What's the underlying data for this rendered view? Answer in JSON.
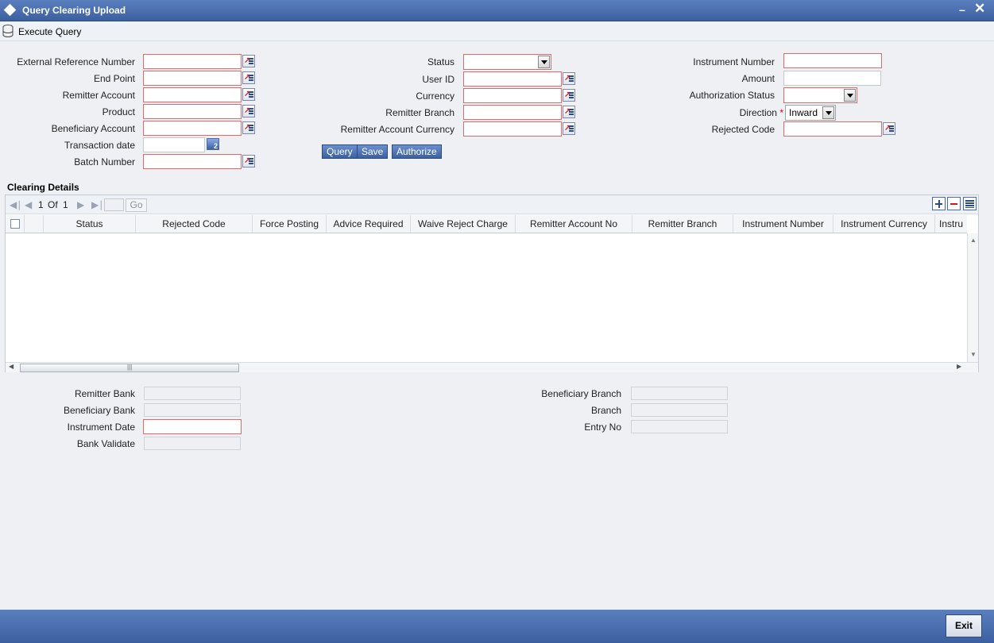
{
  "window": {
    "title": "Query Clearing Upload"
  },
  "toolbar": {
    "execute_query": "Execute Query"
  },
  "form": {
    "external_reference_number": "External Reference Number",
    "end_point": "End Point",
    "remitter_account": "Remitter Account",
    "product": "Product",
    "beneficiary_account": "Beneficiary Account",
    "transaction_date": "Transaction date",
    "batch_number": "Batch Number",
    "status": "Status",
    "user_id": "User ID",
    "currency": "Currency",
    "remitter_branch": "Remitter Branch",
    "remitter_account_currency": "Remitter Account Currency",
    "instrument_number": "Instrument Number",
    "amount": "Amount",
    "authorization_status": "Authorization Status",
    "direction": "Direction",
    "direction_required": "*",
    "direction_value": "Inward",
    "rejected_code": "Rejected Code"
  },
  "buttons": {
    "query": "Query",
    "save": "Save",
    "authorize": "Authorize"
  },
  "clearing_details": {
    "title": "Clearing Details",
    "pager": {
      "current": "1",
      "of": "Of",
      "total": "1",
      "go": "Go"
    },
    "columns": [
      "Status",
      "Rejected Code",
      "Force Posting",
      "Advice Required",
      "Waive Reject Charge",
      "Remitter Account No",
      "Remitter Branch",
      "Instrument Number",
      "Instrument Currency",
      "Instru"
    ]
  },
  "bottom": {
    "remitter_bank": "Remitter Bank",
    "beneficiary_bank": "Beneficiary Bank",
    "instrument_date": "Instrument Date",
    "bank_validate": "Bank Validate",
    "beneficiary_branch": "Beneficiary Branch",
    "branch": "Branch",
    "entry_no": "Entry No"
  },
  "footer": {
    "exit": "Exit"
  }
}
